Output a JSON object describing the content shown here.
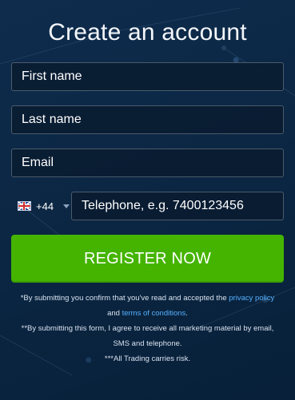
{
  "title": "Create an account",
  "fields": {
    "first_name_placeholder": "First name",
    "last_name_placeholder": "Last name",
    "email_placeholder": "Email",
    "country_code": "+44",
    "telephone_placeholder": "Telephone, e.g. 7400123456"
  },
  "register_label": "REGISTER NOW",
  "legal": {
    "line1_part1": "*By submitting you confirm that you've read and accepted the ",
    "privacy_policy": "privacy policy",
    "and": " and ",
    "terms": "terms of conditions",
    "line1_end": ".",
    "line2": "**By submitting this form, I agree to receive all marketing material by email, SMS and telephone.",
    "line3": "***All Trading carries risk."
  },
  "colors": {
    "background": "#0b2744",
    "button": "#44b400",
    "link": "#56b1ff"
  },
  "icons": {
    "flag": "uk-flag-icon",
    "chevron": "chevron-down-icon"
  }
}
